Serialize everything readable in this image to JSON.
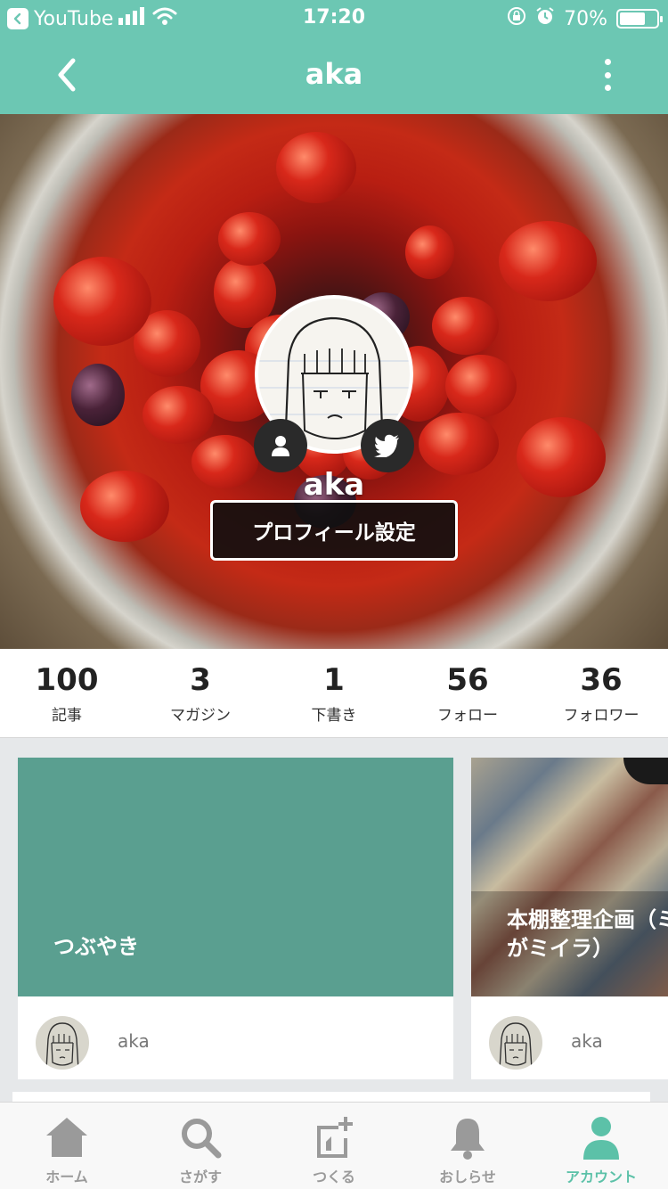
{
  "status_bar": {
    "back_app": "YouTube",
    "time": "17:20",
    "battery": "70%",
    "battery_level": 0.7
  },
  "nav": {
    "title": "aka",
    "back_icon": "chevron-left-icon",
    "more_icon": "more-vertical-icon"
  },
  "profile": {
    "name": "aka",
    "settings_button": "プロフィール設定",
    "user_icon": "user-icon",
    "twitter_icon": "twitter-icon"
  },
  "stats": [
    {
      "value": "100",
      "label": "記事"
    },
    {
      "value": "3",
      "label": "マガジン"
    },
    {
      "value": "1",
      "label": "下書き"
    },
    {
      "value": "56",
      "label": "フォロー"
    },
    {
      "value": "36",
      "label": "フォロワー"
    }
  ],
  "magazines": [
    {
      "title": "つぶやき",
      "author": "aka",
      "cover_color": "#5a9f90"
    },
    {
      "title_line1": "本棚整理企画（ミ",
      "title_line2": "がミイラ）",
      "author": "aka"
    }
  ],
  "tabbar": [
    {
      "label": "ホーム",
      "icon": "home-icon",
      "active": false
    },
    {
      "label": "さがす",
      "icon": "search-icon",
      "active": false
    },
    {
      "label": "つくる",
      "icon": "compose-icon",
      "active": false
    },
    {
      "label": "おしらせ",
      "icon": "bell-icon",
      "active": false
    },
    {
      "label": "アカウント",
      "icon": "account-icon",
      "active": true
    }
  ],
  "colors": {
    "accent": "#6cc7b3",
    "active_tab": "#5cc1a8",
    "inactive_tab": "#9a9a9a"
  }
}
